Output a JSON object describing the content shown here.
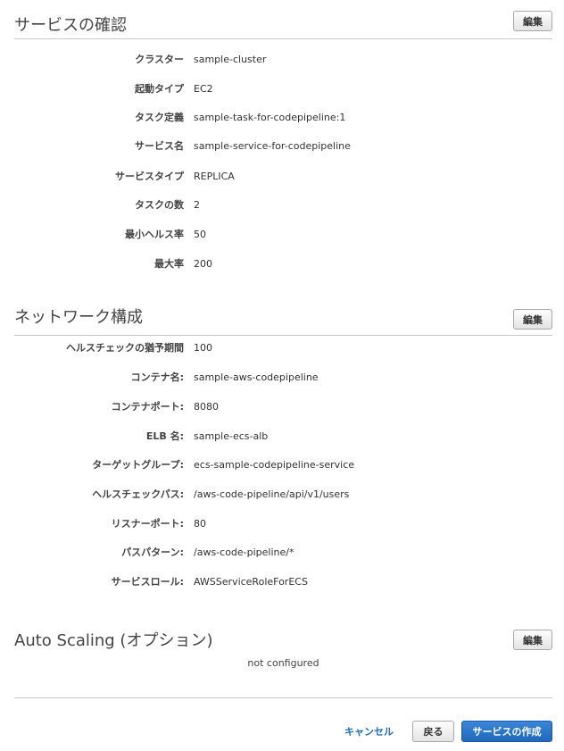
{
  "service_review": {
    "title": "サービスの確認",
    "edit_label": "編集",
    "rows": [
      {
        "label": "クラスター",
        "value": "sample-cluster"
      },
      {
        "label": "起動タイプ",
        "value": "EC2"
      },
      {
        "label": "タスク定義",
        "value": "sample-task-for-codepipeline:1"
      },
      {
        "label": "サービス名",
        "value": "sample-service-for-codepipeline"
      },
      {
        "label": "サービスタイプ",
        "value": "REPLICA"
      },
      {
        "label": "タスクの数",
        "value": "2"
      },
      {
        "label": "最小ヘルス率",
        "value": "50"
      },
      {
        "label": "最大率",
        "value": "200"
      }
    ]
  },
  "network": {
    "title": "ネットワーク構成",
    "edit_label": "編集",
    "rows": [
      {
        "label": "ヘルスチェックの猶予期間",
        "value": "100"
      },
      {
        "label": "コンテナ名:",
        "value": "sample-aws-codepipeline"
      },
      {
        "label": "コンテナポート:",
        "value": "8080"
      },
      {
        "label": "ELB 名:",
        "value": "sample-ecs-alb"
      },
      {
        "label": "ターゲットグループ:",
        "value": "ecs-sample-codepipeline-service"
      },
      {
        "label": "ヘルスチェックパス:",
        "value": "/aws-code-pipeline/api/v1/users"
      },
      {
        "label": "リスナーポート:",
        "value": "80"
      },
      {
        "label": "パスパターン:",
        "value": "/aws-code-pipeline/*"
      },
      {
        "label": "サービスロール:",
        "value": "AWSServiceRoleForECS"
      }
    ]
  },
  "auto_scaling": {
    "title": "Auto Scaling (オプション)",
    "edit_label": "編集",
    "status": "not configured"
  },
  "footer": {
    "cancel_label": "キャンセル",
    "back_label": "戻る",
    "create_label": "サービスの作成"
  },
  "colors": {
    "primary": "#1f68bd",
    "link": "#1f6ebc",
    "divider": "#c7c7c7"
  }
}
